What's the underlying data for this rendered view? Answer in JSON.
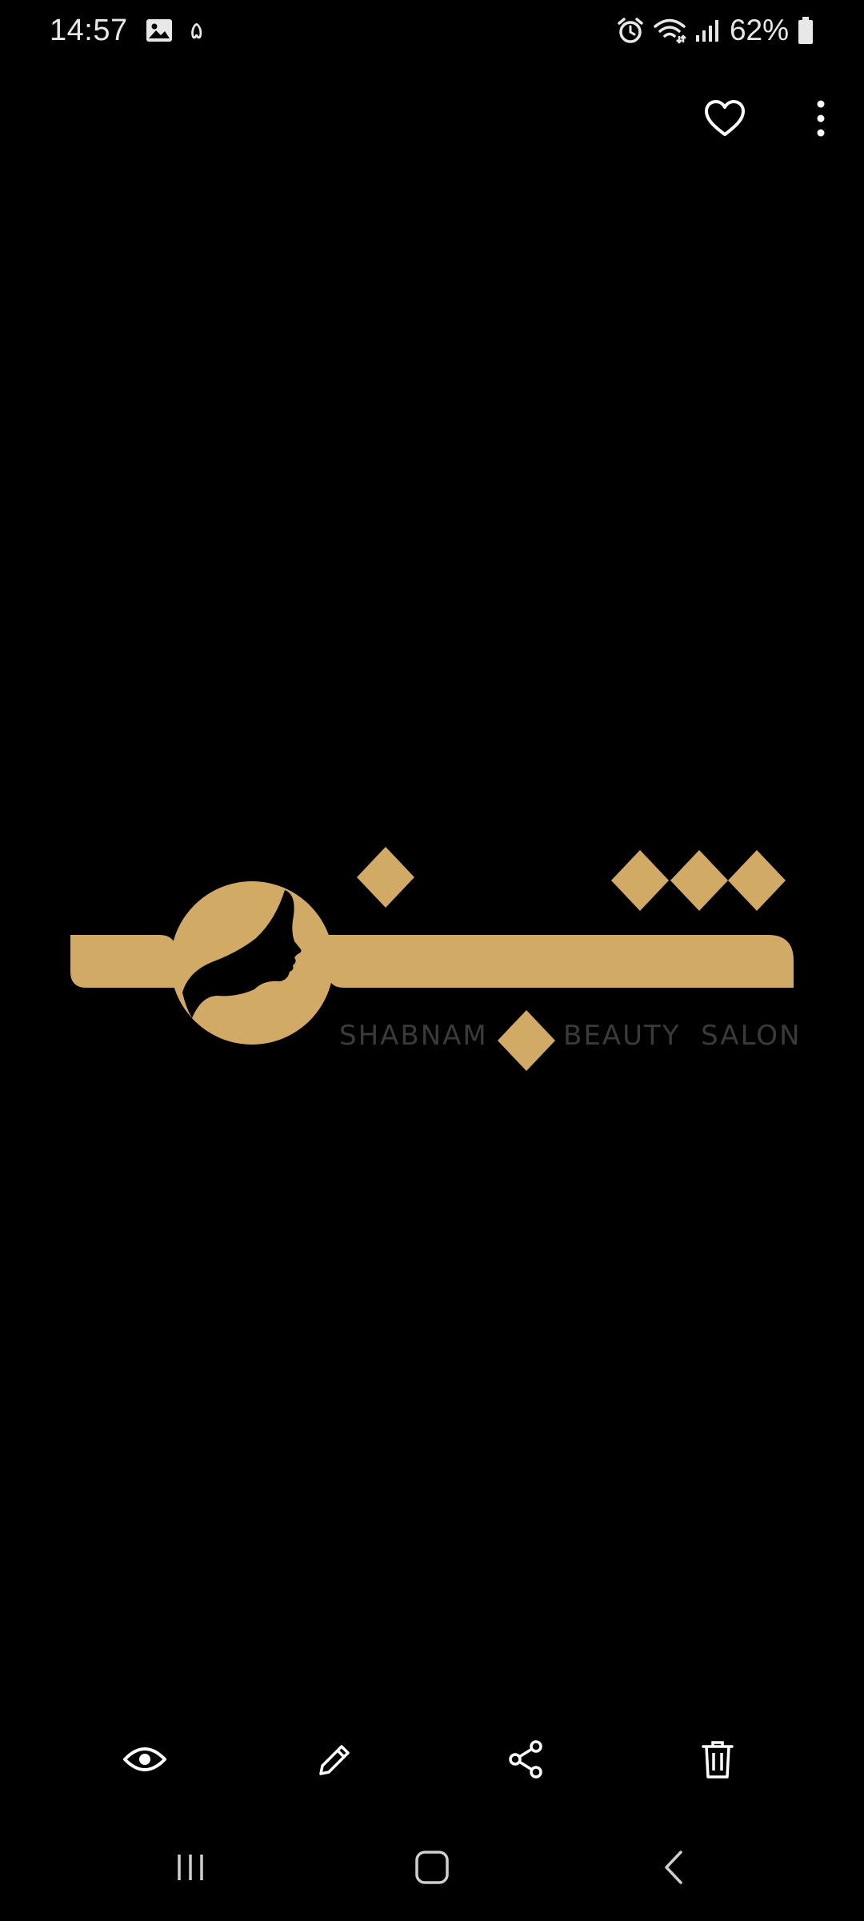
{
  "status_bar": {
    "time": "14:57",
    "notification_digit": "۵",
    "battery_percent": "62%",
    "icons": [
      "gallery-icon",
      "alarm-icon",
      "wifi-icon",
      "signal-icon",
      "battery-icon"
    ]
  },
  "top_actions": {
    "icons": [
      "heart-icon",
      "more-vertical-icon"
    ]
  },
  "image": {
    "caption_left": "SHABNAM",
    "caption_right": "BEAUTY  SALON",
    "colors": {
      "gold": "#D1AA65",
      "caption_gray": "#3a3a3a",
      "background": "#000000"
    }
  },
  "bottom_toolbar": {
    "icons": [
      "eye-icon",
      "pencil-icon",
      "share-icon",
      "trash-icon"
    ]
  },
  "nav_bar": {
    "icons": [
      "recents-icon",
      "home-icon",
      "back-icon"
    ]
  }
}
